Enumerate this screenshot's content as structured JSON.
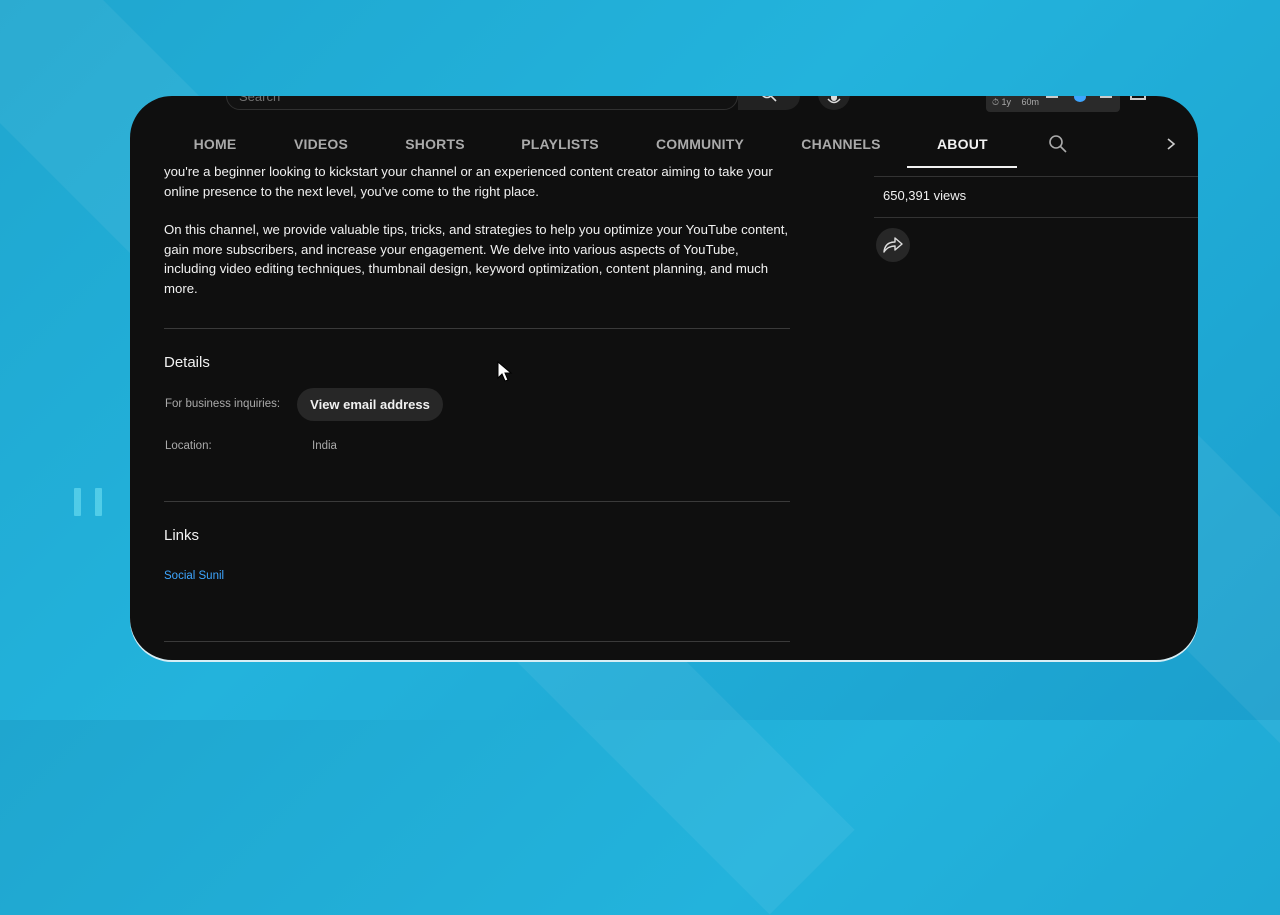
{
  "topbar": {
    "search_placeholder": "Search",
    "ext_time": "⏱ 1y",
    "ext_minutes": "60m"
  },
  "tabs": [
    {
      "label": "HOME"
    },
    {
      "label": "VIDEOS"
    },
    {
      "label": "SHORTS"
    },
    {
      "label": "PLAYLISTS"
    },
    {
      "label": "COMMUNITY"
    },
    {
      "label": "CHANNELS"
    },
    {
      "label": "ABOUT",
      "active": true
    }
  ],
  "description": {
    "para1": "you're a beginner looking to kickstart your channel or an experienced content creator aiming to take your online presence to the next level, you've come to the right place.",
    "para2": "On this channel, we provide valuable tips, tricks, and strategies to help you optimize your YouTube content, gain more subscribers, and increase your engagement. We delve into various aspects of YouTube, including video editing techniques, thumbnail design, keyword optimization, content planning, and much more."
  },
  "details": {
    "heading": "Details",
    "business_label": "For business inquiries:",
    "email_button": "View email address",
    "location_label": "Location:",
    "location_value": "India"
  },
  "links": {
    "heading": "Links",
    "items": [
      {
        "label": "Social Sunil"
      }
    ]
  },
  "stats": {
    "views": "650,391 views"
  },
  "icons": {
    "search": "search-icon",
    "mic": "mic-icon",
    "share": "share-icon",
    "next": "chevron-right-icon",
    "cursor": "mouse-cursor-icon"
  },
  "colors": {
    "background": "#1fa6cf",
    "panel": "#0f0f0f",
    "text": "#f1f1f1",
    "muted": "#aaaaaa",
    "link": "#3ea6ff"
  }
}
